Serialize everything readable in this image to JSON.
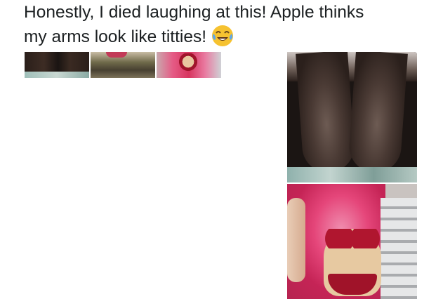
{
  "tweet": {
    "text_line1": "Honestly, I died laughing at this! Apple thinks",
    "text_line2": "my arms look like titties!",
    "emoji": "face-with-tears-of-joy-icon"
  },
  "media": {
    "thumbnails": [
      {
        "name": "thumbnail-1"
      },
      {
        "name": "thumbnail-2"
      },
      {
        "name": "thumbnail-3"
      }
    ],
    "photos": [
      {
        "name": "photo-legs"
      },
      {
        "name": "photo-figurine"
      }
    ]
  }
}
